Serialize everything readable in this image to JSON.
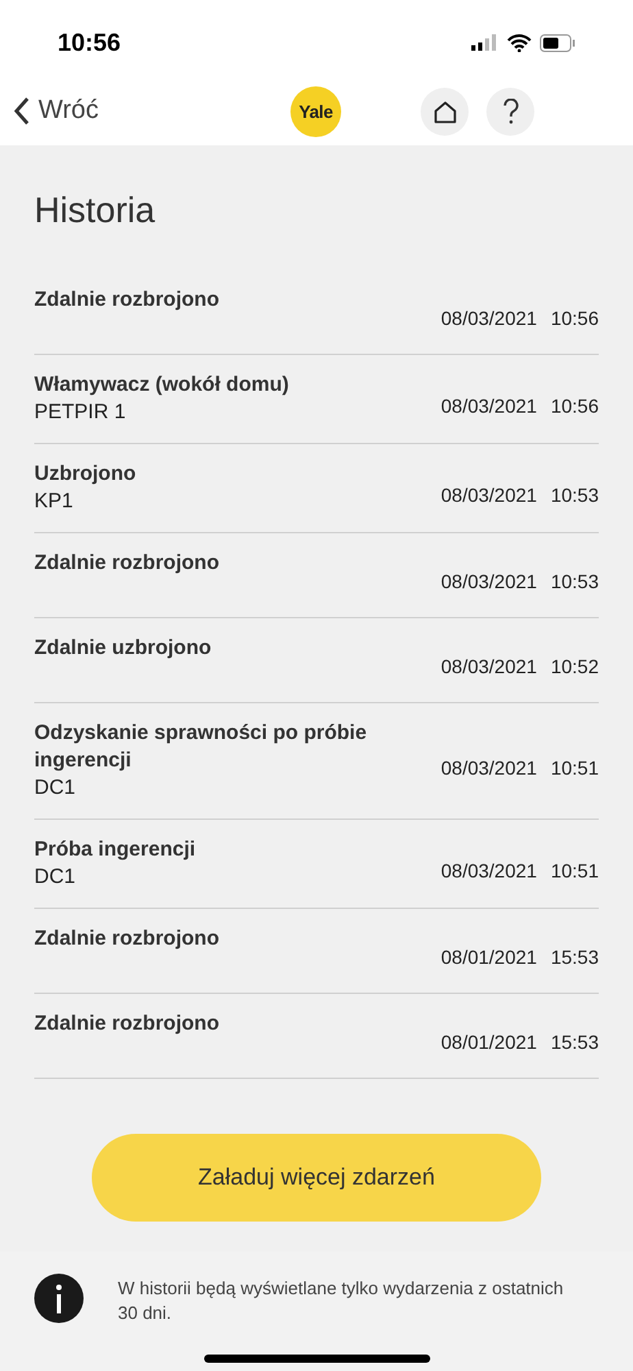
{
  "status_bar": {
    "time": "10:56"
  },
  "nav": {
    "back": "Wróć",
    "logo": "Yale"
  },
  "title": "Historia",
  "events": [
    {
      "title": "Zdalnie rozbrojono",
      "date": "08/03/2021",
      "time": "10:56"
    },
    {
      "title": "Włamywacz (wokół domu)",
      "subtitle": "PETPIR 1",
      "date": "08/03/2021",
      "time": "10:56"
    },
    {
      "title": "Uzbrojono",
      "subtitle": "KP1",
      "date": "08/03/2021",
      "time": "10:53"
    },
    {
      "title": "Zdalnie rozbrojono",
      "date": "08/03/2021",
      "time": "10:53"
    },
    {
      "title": "Zdalnie uzbrojono",
      "date": "08/03/2021",
      "time": "10:52"
    },
    {
      "title": "Odzyskanie sprawności po próbie ingerencji",
      "subtitle": "DC1",
      "date": "08/03/2021",
      "time": "10:51"
    },
    {
      "title": "Próba ingerencji",
      "subtitle": "DC1",
      "date": "08/03/2021",
      "time": "10:51"
    },
    {
      "title": "Zdalnie rozbrojono",
      "date": "08/01/2021",
      "time": "15:53"
    },
    {
      "title": "Zdalnie rozbrojono",
      "date": "08/01/2021",
      "time": "15:53"
    }
  ],
  "load_more": "Załaduj więcej zdarzeń",
  "info": "W historii będą wyświetlane tylko wydarzenia z ostatnich 30 dni."
}
